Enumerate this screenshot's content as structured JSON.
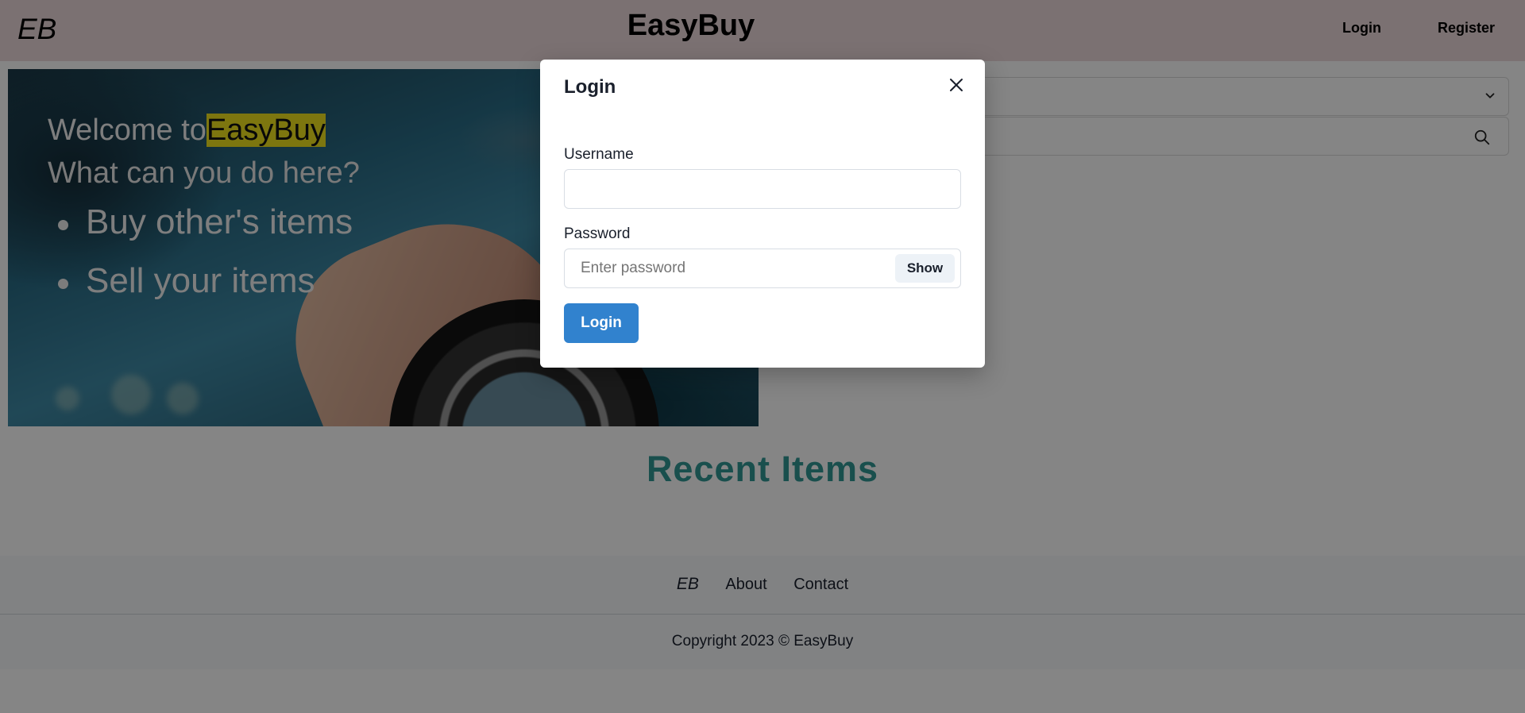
{
  "header": {
    "logo": "EB",
    "brand": "EasyBuy",
    "nav": {
      "login": "Login",
      "register": "Register"
    }
  },
  "hero": {
    "welcome_prefix": "Welcome to",
    "welcome_highlight": "EasyBuy",
    "question": "What can you do here?",
    "items": [
      "Buy other's items",
      "Sell your items"
    ]
  },
  "filters": {
    "category_select_icon": "chevron-down-icon",
    "search_icon": "search-icon"
  },
  "main": {
    "recent_title": "Recent Items"
  },
  "footer": {
    "logo": "EB",
    "links": {
      "about": "About",
      "contact": "Contact"
    },
    "copyright": "Copyright 2023 © EasyBuy"
  },
  "modal": {
    "title": "Login",
    "username_label": "Username",
    "username_value": "",
    "password_label": "Password",
    "password_placeholder": "Enter password",
    "show_label": "Show",
    "submit_label": "Login",
    "close_icon": "close-icon"
  },
  "colors": {
    "header_bg": "#ecd9da",
    "highlight": "#f0e21e",
    "recent_title": "#319795",
    "primary_button": "#3182ce"
  }
}
